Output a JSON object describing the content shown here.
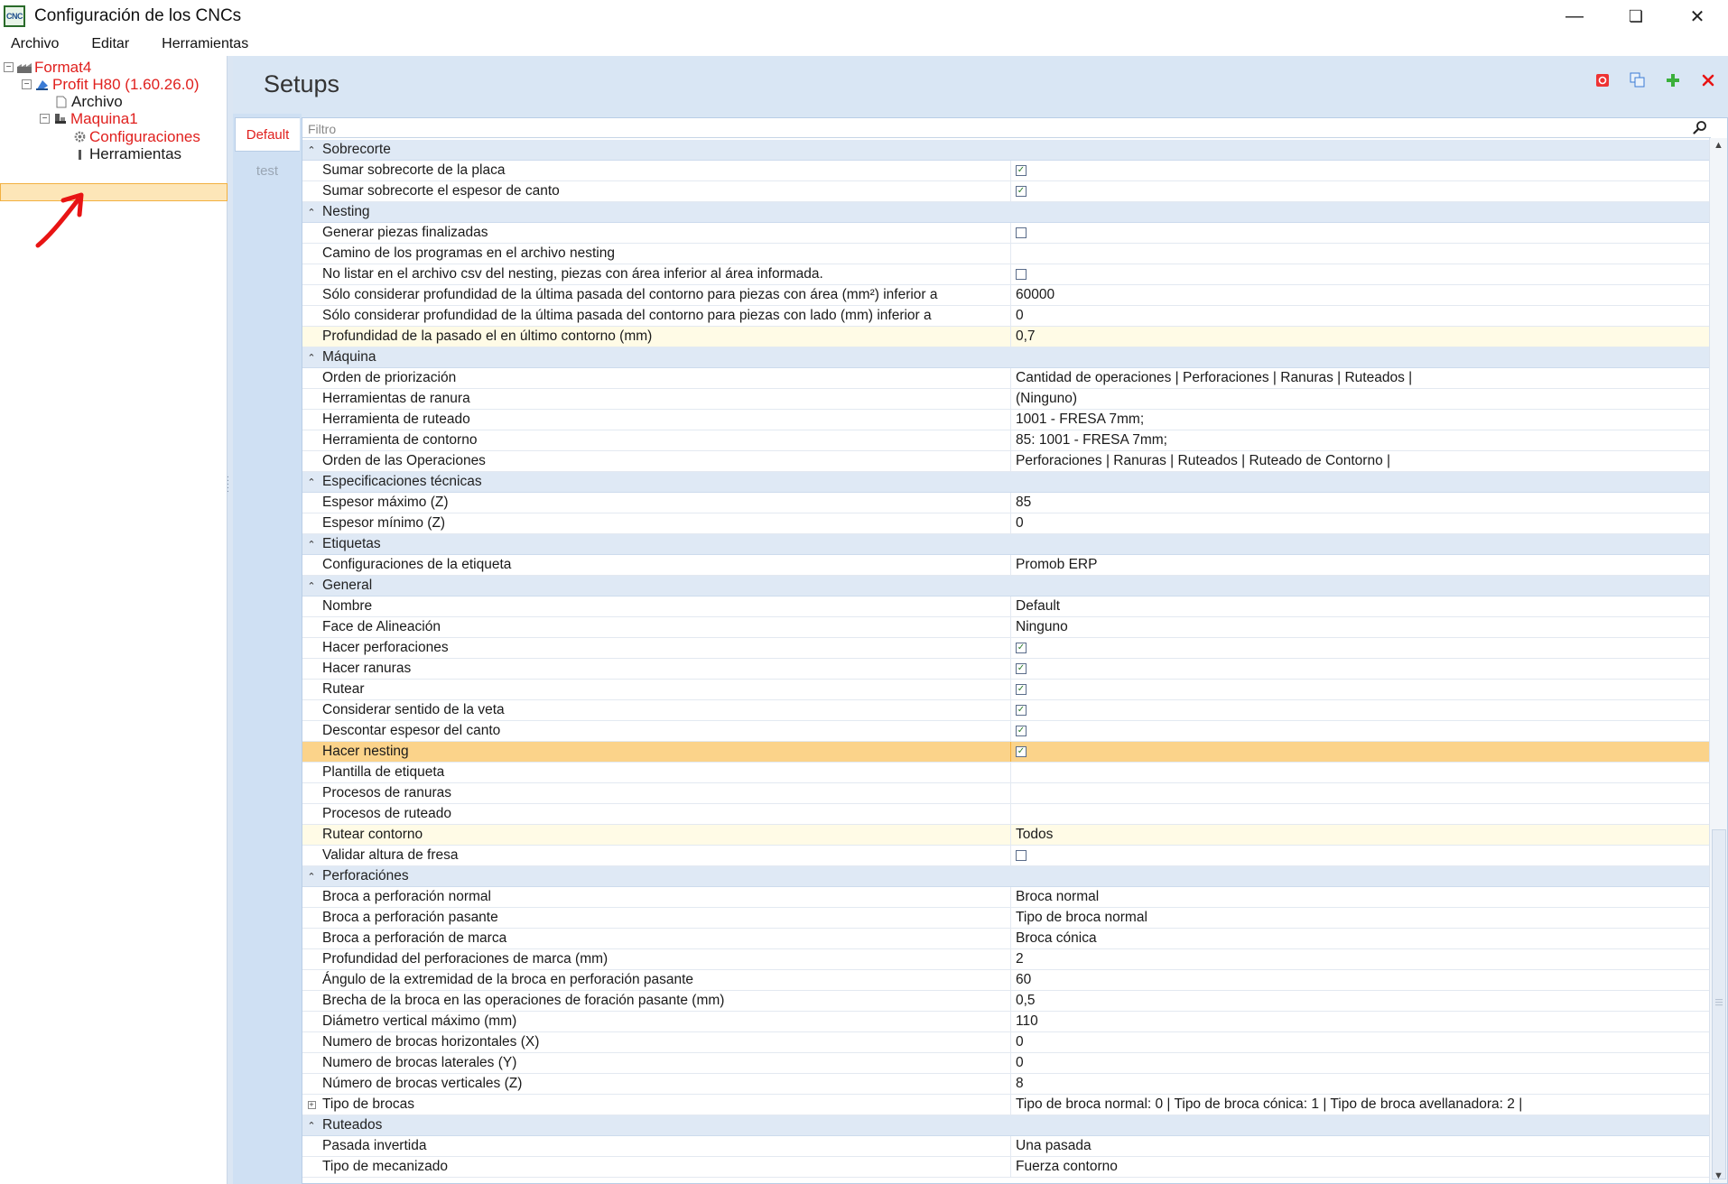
{
  "window": {
    "title": "Configuración de los CNCs",
    "app_icon_text": "CNC"
  },
  "menu": [
    "Archivo",
    "Editar",
    "Herramientas"
  ],
  "tree": {
    "format": "Format4",
    "profit": "Profit H80 (1.60.26.0)",
    "archivo": "Archivo",
    "maquina": "Maquina1",
    "configuraciones": "Configuraciones",
    "herramientas": "Herramientas"
  },
  "header": {
    "title": "Setups"
  },
  "tabs": [
    "Default",
    "test"
  ],
  "filter": {
    "placeholder": "Filtro"
  },
  "grid": [
    {
      "type": "cat",
      "label": "Sobrecorte"
    },
    {
      "label": "Sumar sobrecorte de la placa",
      "check": true
    },
    {
      "label": "Sumar sobrecorte el espesor de canto",
      "check": true
    },
    {
      "type": "cat",
      "label": "Nesting"
    },
    {
      "label": "Generar piezas finalizadas",
      "check": false
    },
    {
      "label": "Camino de los programas en el archivo nesting",
      "value": ""
    },
    {
      "label": "No listar en el archivo csv del nesting, piezas con área inferior al área informada.",
      "check": false
    },
    {
      "label": "Sólo considerar profundidad de la última pasada del contorno para piezas con área (mm²) inferior a",
      "value": "60000"
    },
    {
      "label": "Sólo considerar profundidad de la última pasada del contorno para piezas con lado (mm) inferior a",
      "value": "0"
    },
    {
      "label": "Profundidad de la pasado el en último contorno (mm)",
      "value": "0,7",
      "hl": "light"
    },
    {
      "type": "cat",
      "label": "Máquina"
    },
    {
      "label": "Orden de priorización",
      "value": "Cantidad de operaciones | Perforaciones | Ranuras | Ruteados |"
    },
    {
      "label": "Herramientas de ranura",
      "value": "(Ninguno)"
    },
    {
      "label": "Herramienta de ruteado",
      "value": "1001 - FRESA 7mm;"
    },
    {
      "label": "Herramienta de contorno",
      "value": "85: 1001 - FRESA 7mm;"
    },
    {
      "label": "Orden de las Operaciones",
      "value": "Perforaciones | Ranuras | Ruteados | Ruteado de Contorno |"
    },
    {
      "type": "cat",
      "label": "Especificaciones técnicas"
    },
    {
      "label": "Espesor máximo (Z)",
      "value": "85"
    },
    {
      "label": "Espesor mínimo (Z)",
      "value": "0"
    },
    {
      "type": "cat",
      "label": "Etiquetas"
    },
    {
      "label": "Configuraciones de la etiqueta",
      "value": "Promob ERP"
    },
    {
      "type": "cat",
      "label": "General"
    },
    {
      "label": "Nombre",
      "value": "Default"
    },
    {
      "label": "Face de Alineación",
      "value": "Ninguno"
    },
    {
      "label": "Hacer perforaciones",
      "check": true
    },
    {
      "label": "Hacer ranuras",
      "check": true
    },
    {
      "label": "Rutear",
      "check": true
    },
    {
      "label": "Considerar sentido de la veta",
      "check": true
    },
    {
      "label": "Descontar espesor del canto",
      "check": true
    },
    {
      "label": "Hacer nesting",
      "check": true,
      "hl": "orange"
    },
    {
      "label": "Plantilla de etiqueta",
      "value": ""
    },
    {
      "label": "Procesos de ranuras",
      "value": ""
    },
    {
      "label": "Procesos de ruteado",
      "value": ""
    },
    {
      "label": "Rutear contorno",
      "value": "Todos",
      "hl": "light"
    },
    {
      "label": "Validar altura de fresa",
      "check": false
    },
    {
      "type": "cat",
      "label": "Perforaciónes"
    },
    {
      "label": "Broca a perforación normal",
      "value": "Broca normal"
    },
    {
      "label": "Broca a perforación pasante",
      "value": "Tipo de broca normal"
    },
    {
      "label": "Broca a perforación de marca",
      "value": "Broca cónica"
    },
    {
      "label": "Profundidad del perforaciones de marca (mm)",
      "value": "2"
    },
    {
      "label": "Ángulo de la extremidad de la broca en perforación pasante",
      "value": "60"
    },
    {
      "label": "Brecha de la broca en las operaciones de foración pasante (mm)",
      "value": "0,5"
    },
    {
      "label": "Diámetro vertical máximo (mm)",
      "value": "110"
    },
    {
      "label": "Numero de brocas horizontales (X)",
      "value": "0"
    },
    {
      "label": "Numero de brocas laterales (Y)",
      "value": "0"
    },
    {
      "label": "Número de brocas verticales (Z)",
      "value": "8"
    },
    {
      "label": "Tipo de brocas",
      "value": "Tipo de broca normal: 0  |  Tipo de broca cónica: 1  |  Tipo de broca avellanadora: 2  |",
      "expand": true
    },
    {
      "type": "cat",
      "label": "Ruteados"
    },
    {
      "label": "Pasada invertida",
      "value": "Una pasada"
    },
    {
      "label": "Tipo de mecanizado",
      "value": "Fuerza contorno"
    }
  ]
}
